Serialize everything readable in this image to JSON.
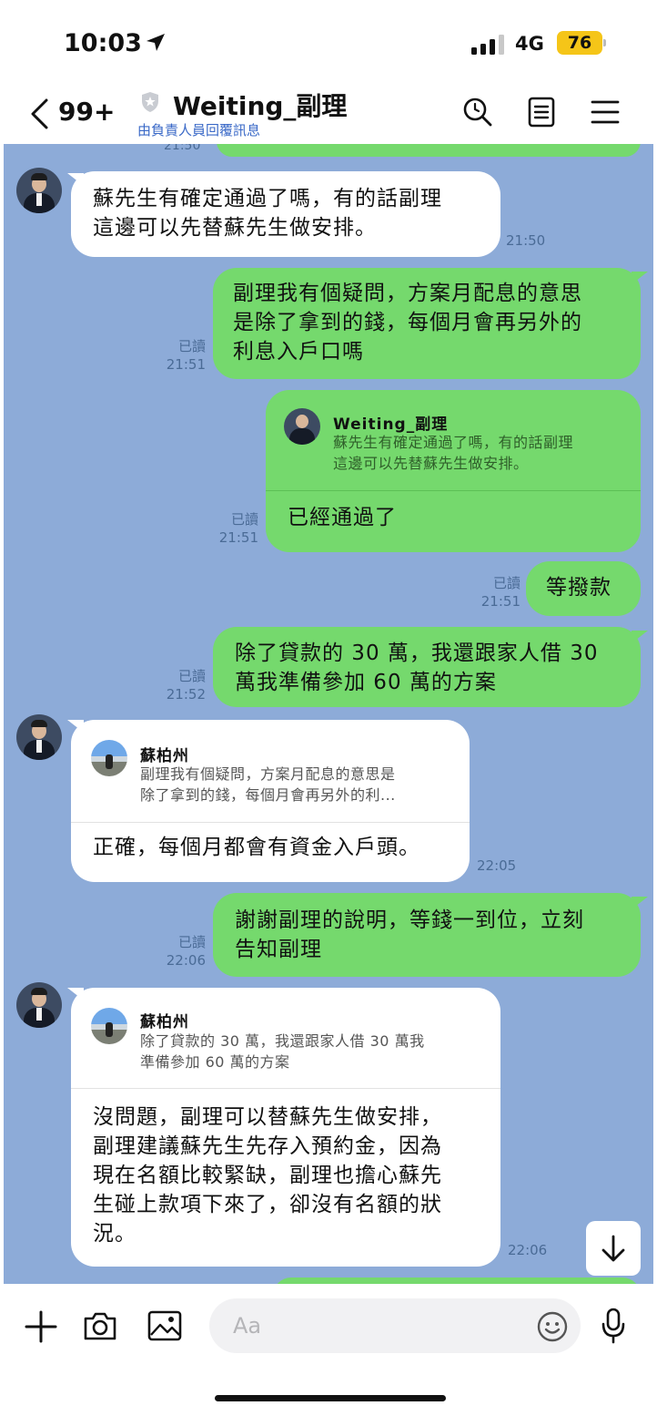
{
  "status_bar": {
    "time": "10:03",
    "network": "4G",
    "battery": "76"
  },
  "header": {
    "back_count": "99+",
    "title": "Weiting_副理",
    "subtitle": "由負責人員回覆訊息"
  },
  "chat": {
    "clipped_time": "21:50",
    "messages": [
      {
        "side": "left",
        "text": "蘇先生有確定通過了嗎，有的話副理\n這邊可以先替蘇先生做安排。",
        "time": "21:50"
      },
      {
        "side": "right",
        "read": "已讀",
        "text": "副理我有個疑問，方案月配息的意思\n是除了拿到的錢，每個月會再另外的\n利息入戶口嗎",
        "time": "21:51"
      },
      {
        "side": "right",
        "read": "已讀",
        "quote": {
          "name": "Weiting_副理",
          "text": "蘇先生有確定通過了嗎，有的話副理\n這邊可以先替蘇先生做安排。"
        },
        "text": "已經通過了",
        "time": "21:51"
      },
      {
        "side": "right",
        "read": "已讀",
        "text": "等撥款",
        "time": "21:51"
      },
      {
        "side": "right",
        "read": "已讀",
        "text": "除了貸款的 30 萬，我還跟家人借 30\n萬我準備參加 60 萬的方案",
        "time": "21:52"
      },
      {
        "side": "left",
        "quote": {
          "name": "蘇柏州",
          "text": "副理我有個疑問，方案月配息的意思是\n除了拿到的錢，每個月會再另外的利..."
        },
        "text": "正確，每個月都會有資金入戶頭。",
        "time": "22:05"
      },
      {
        "side": "right",
        "read": "已讀",
        "text": "謝謝副理的說明，等錢一到位，立刻\n告知副理",
        "time": "22:06"
      },
      {
        "side": "left",
        "quote": {
          "name": "蘇柏州",
          "text": "除了貸款的 30 萬，我還跟家人借 30 萬我\n準備參加 60 萬的方案"
        },
        "text": "沒問題，副理可以替蘇先生做安排，\n副理建議蘇先生先存入預約金，因為\n現在名額比較緊缺，副理也擔心蘇先\n生碰上款項下來了，卻沒有名額的狀\n況。",
        "time": "22:06"
      }
    ]
  },
  "input": {
    "placeholder": "Aa"
  },
  "colors": {
    "chat_bg": "#8dabd8",
    "green_bubble": "#75d96d",
    "battery": "#f5c518",
    "subtitle": "#3a69c7"
  },
  "icons": [
    "location-arrow-icon",
    "signal-icon",
    "back-chevron-icon",
    "shield-icon",
    "search-icon",
    "note-icon",
    "menu-icon",
    "scroll-down-icon",
    "plus-icon",
    "camera-icon",
    "image-icon",
    "emoji-icon",
    "mic-icon"
  ]
}
